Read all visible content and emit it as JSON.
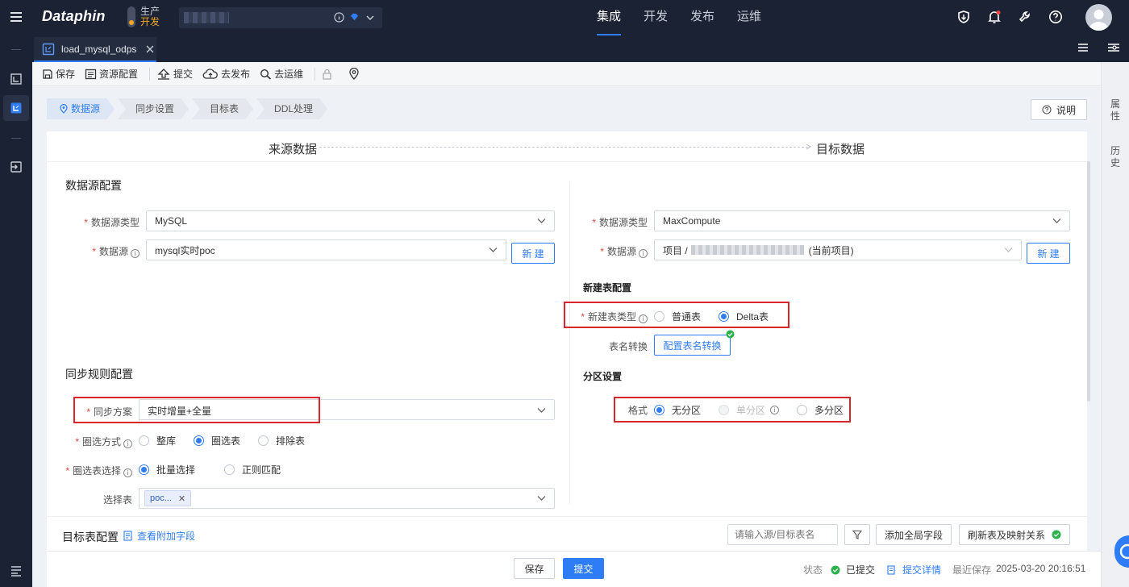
{
  "app": {
    "logo": "Dataphin"
  },
  "env": {
    "line1": "生产",
    "line2": "开发"
  },
  "project": {
    "info_icon": "info-icon",
    "type_icon": "diamond-icon"
  },
  "nav": [
    {
      "label": "集成",
      "active": true
    },
    {
      "label": "开发",
      "active": false
    },
    {
      "label": "发布",
      "active": false
    },
    {
      "label": "运维",
      "active": false
    }
  ],
  "topicons": [
    "shield-icon",
    "bell-icon",
    "wrench-icon",
    "help-icon"
  ],
  "tab": {
    "title": "load_mysql_odps"
  },
  "toolbar": {
    "save": "保存",
    "resource": "资源配置",
    "submit": "提交",
    "publish": "去发布",
    "ops": "去运维"
  },
  "rightrail": {
    "props": "属性",
    "history": "历史"
  },
  "steps": [
    "数据源",
    "同步设置",
    "目标表",
    "DDL处理"
  ],
  "help_label": "说明",
  "flow": {
    "source": "来源数据",
    "target": "目标数据"
  },
  "source": {
    "section": "数据源配置",
    "type_label": "数据源类型",
    "type_value": "MySQL",
    "ds_label": "数据源",
    "ds_value": "mysql实时poc",
    "new_btn": "新 建"
  },
  "target": {
    "type_label": "数据源类型",
    "type_value": "MaxCompute",
    "ds_label": "数据源",
    "ds_prefix": "项目 /",
    "ds_suffix": "(当前项目)",
    "new_btn": "新 建",
    "newtable_section": "新建表配置",
    "newtable_type_label": "新建表类型",
    "newtable_opt1": "普通表",
    "newtable_opt2": "Delta表",
    "tablename_label": "表名转换",
    "tablename_btn": "配置表名转换",
    "partition_section": "分区设置",
    "format_label": "格式",
    "part_opt1": "无分区",
    "part_opt2": "单分区",
    "part_opt3": "多分区"
  },
  "sync": {
    "section": "同步规则配置",
    "plan_label": "同步方案",
    "plan_value": "实时增量+全量",
    "scope_label": "圈选方式",
    "scope_opt1": "整库",
    "scope_opt2": "圈选表",
    "scope_opt3": "排除表",
    "pick_label": "圈选表选择",
    "pick_opt1": "批量选择",
    "pick_opt2": "正则匹配",
    "table_label": "选择表",
    "table_tag": "poc..."
  },
  "target_table": {
    "section": "目标表配置",
    "view_extra": "查看附加字段",
    "search_placeholder": "请输入源/目标表名",
    "add_global": "添加全局字段",
    "refresh": "刷新表及映射关系"
  },
  "footer": {
    "save": "保存",
    "submit": "提交",
    "status_label": "状态",
    "status_value": "已提交",
    "detail": "提交详情",
    "last_saved_label": "最近保存",
    "last_saved_time": "2025-03-20 20:16:51"
  },
  "colors": {
    "accent": "#2f7df6",
    "topbar": "#1b2233",
    "highlight": "#d9262c",
    "success": "#2bb24c",
    "env": "#f5a623"
  }
}
